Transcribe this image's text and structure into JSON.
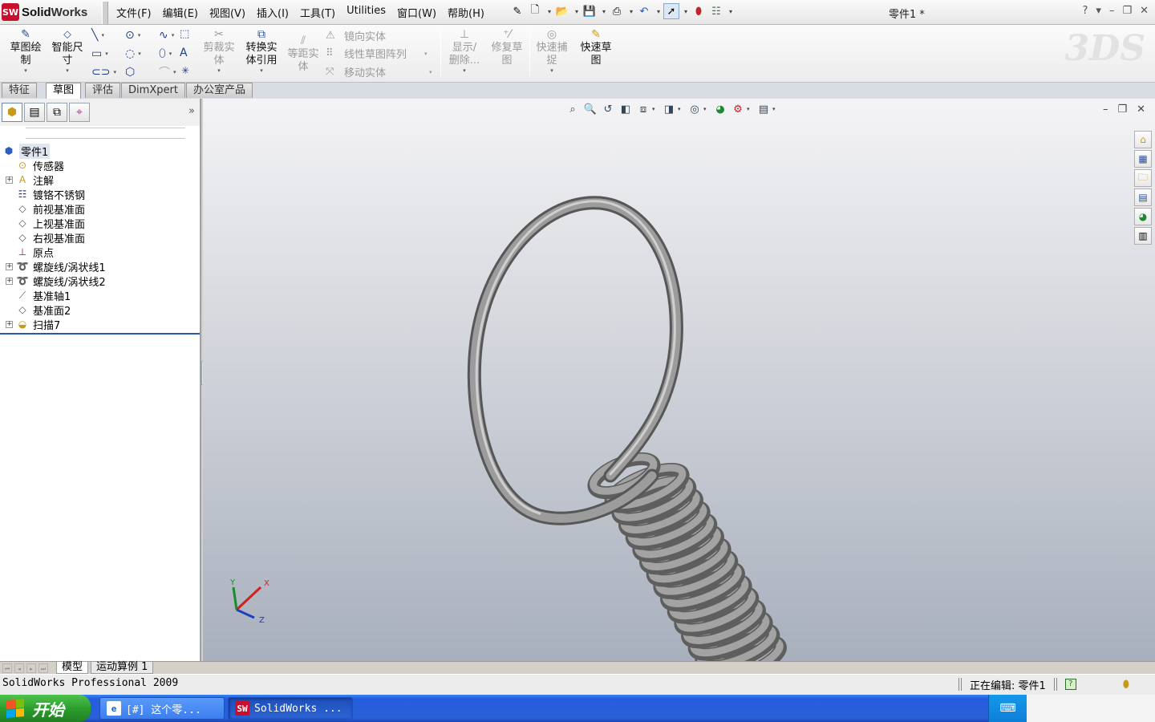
{
  "app": {
    "brand_badge": "SW",
    "brand_name_a": "Solid",
    "brand_name_b": "Works",
    "document_title": "零件1 *",
    "window_controls": [
      "?",
      "▾",
      "–",
      "❐",
      "✕"
    ]
  },
  "menu": [
    "文件(F)",
    "编辑(E)",
    "视图(V)",
    "插入(I)",
    "工具(T)",
    "Utilities",
    "窗口(W)",
    "帮助(H)"
  ],
  "quick_tools": {
    "icons": [
      "pin-icon",
      "new-document-icon",
      "open-folder-icon",
      "save-icon",
      "print-icon",
      "undo-icon",
      "select-arrow-icon",
      "rebuild-traffic-light-icon",
      "options-icon"
    ]
  },
  "command_manager": {
    "sketch": "草图绘\n制",
    "smart_dimension": "智能尺\n寸",
    "trim": "剪裁实\n体",
    "convert": "转换实\n体引用",
    "offset": "等距实\n体",
    "mirror": "镜向实体",
    "linear_pattern": "线性草图阵列",
    "move": "移动实体",
    "show_delete": "显示/\n删除...",
    "repair": "修复草\n图",
    "quick_snaps": "快速捕\n捉",
    "rapid_sketch": "快速草\n图"
  },
  "tabs": [
    "特征",
    "草图",
    "评估",
    "DimXpert",
    "办公室产品"
  ],
  "active_tab": "草图",
  "feature_tree": {
    "root": "零件1",
    "items": [
      {
        "label": "传感器",
        "icon": "sensor-icon",
        "expandable": false
      },
      {
        "label": "注解",
        "icon": "annotation-icon",
        "expandable": true
      },
      {
        "label": "镀铬不锈钢",
        "icon": "material-icon",
        "expandable": false
      },
      {
        "label": "前视基准面",
        "icon": "plane-icon",
        "expandable": false
      },
      {
        "label": "上视基准面",
        "icon": "plane-icon",
        "expandable": false
      },
      {
        "label": "右视基准面",
        "icon": "plane-icon",
        "expandable": false
      },
      {
        "label": "原点",
        "icon": "origin-icon",
        "expandable": false
      },
      {
        "label": "螺旋线/涡状线1",
        "icon": "helix-icon",
        "expandable": true
      },
      {
        "label": "螺旋线/涡状线2",
        "icon": "helix-icon",
        "expandable": true
      },
      {
        "label": "基准轴1",
        "icon": "axis-icon",
        "expandable": false
      },
      {
        "label": "基准面2",
        "icon": "plane-icon",
        "expandable": false
      },
      {
        "label": "扫描7",
        "icon": "sweep-icon",
        "expandable": true
      }
    ]
  },
  "triad": {
    "x": "X",
    "y": "Y",
    "z": "Z"
  },
  "model_tabs": [
    "模型",
    "运动算例 1"
  ],
  "status": {
    "left": "SolidWorks Professional 2009",
    "editing": "正在编辑: 零件1"
  },
  "taskbar": {
    "start": "开始",
    "buttons": [
      {
        "label": "[#] 这个零...",
        "icon": "ie-icon",
        "active": false
      },
      {
        "label": "SolidWorks ...",
        "icon": "solidworks-icon",
        "active": true
      }
    ]
  },
  "colors": {
    "brand_red": "#c8102e",
    "tree_rollback": "#2c5aa0",
    "xp_taskbar": "#245ede",
    "xp_start": "#2d9e2d"
  }
}
